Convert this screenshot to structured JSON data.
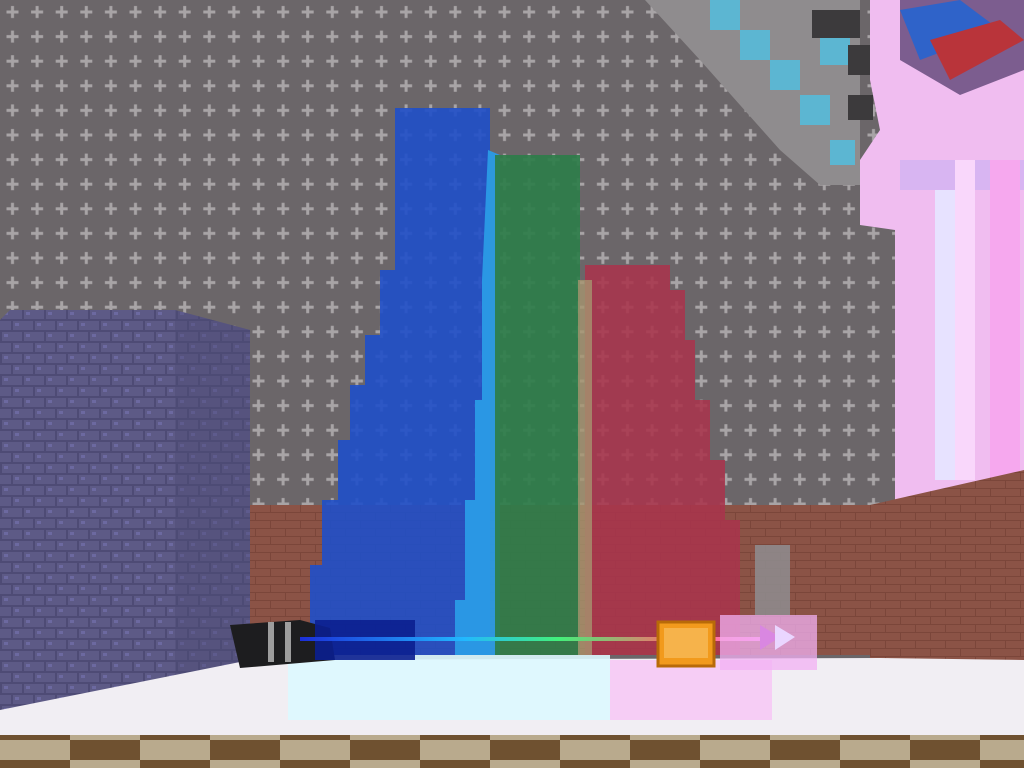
{
  "viewport": {
    "title": "",
    "description_visible_text": ""
  },
  "scene": {
    "palette": {
      "wall": "#6b6669",
      "wall_plus": "#a8a4a6",
      "blue_column": "#1f4fc9",
      "blue_light_column": "#2a9be6",
      "green_column": "#2e7d4a",
      "red_column": "#a8344c",
      "brick_floor_wall": "#8b5346",
      "left_block": "#5d5a86",
      "snow_floor": "#f1eef3",
      "glass_cyan": "#ddf8ff",
      "glass_pink": "#f7c7f5",
      "orange_block": "#f29a1c",
      "checker_dark": "#6f5130",
      "checker_light": "#b9aa8d",
      "pink_sky": "#f0bdf0"
    },
    "entities": [
      {
        "name": "rainbow-beam",
        "kind": "line"
      },
      {
        "name": "orange-block",
        "kind": "block"
      },
      {
        "name": "glass-arrow-block",
        "kind": "block"
      }
    ]
  }
}
